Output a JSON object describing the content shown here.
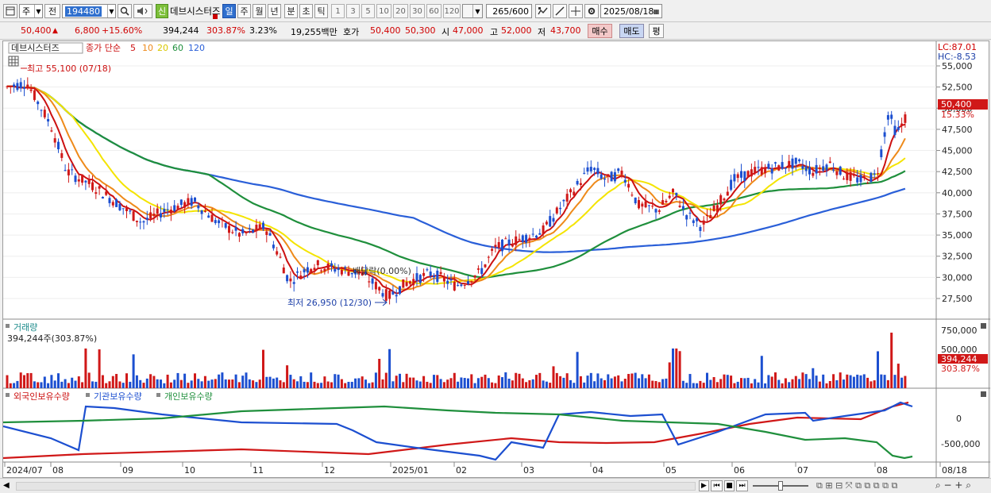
{
  "toolbar": {
    "market_select": "주",
    "type_label": "전",
    "code": "194480",
    "new_badge": "신",
    "stock_name": "데브시스터즈",
    "periods": [
      "일",
      "주",
      "월",
      "년",
      "분",
      "초",
      "틱"
    ],
    "active_period": "일",
    "intervals": [
      "1",
      "3",
      "5",
      "10",
      "20",
      "30",
      "60",
      "120"
    ],
    "count": "265",
    "count_total": "/600",
    "date": "2025/08/18"
  },
  "quote": {
    "price": "50,400",
    "change": "6,800",
    "change_pct": "+15.60%",
    "volume": "394,244",
    "volume_ratio": "303.87%",
    "turnover": "3.23%",
    "amount": "19,255백만",
    "ask_label": "호가",
    "ask": "50,400",
    "bid": "50,300",
    "open_label": "시",
    "open": "47,000",
    "high_label": "고",
    "high": "52,000",
    "low_label": "저",
    "low": "43,700",
    "buy_label": "매수",
    "sell_label": "매도",
    "eval_label": "평"
  },
  "legend": {
    "name": "데브시스터즈",
    "ma_label": "종가 단순",
    "ma_periods": [
      "5",
      "10",
      "20",
      "60",
      "120"
    ],
    "ma_colors": [
      "#cc1010",
      "#ee8a1a",
      "#f4e400",
      "#1f8f3c",
      "#2a5fd8"
    ]
  },
  "annotations": {
    "high": "최고 55,100 (07/18)",
    "low": "최저 26,950 (12/30)",
    "event": "배당락(0.00%)",
    "lc": "LC:87.01",
    "hc": "HC:-8.53",
    "price_tag": "50,400",
    "pct_tag": "15.33%"
  },
  "price_axis": [
    "55,000",
    "52,500",
    "50,000",
    "47,500",
    "45,000",
    "42,500",
    "40,000",
    "37,500",
    "35,000",
    "32,500",
    "30,000",
    "27,500"
  ],
  "volume_pane": {
    "title": "거래량",
    "value": "394,244주(303.87%)",
    "axis": [
      "750,000",
      "500,000"
    ],
    "tag": "394,244",
    "pct": "303.87%"
  },
  "holdings_pane": {
    "foreign": "외국인보유수량",
    "institution": "기관보유수량",
    "individual": "개인보유수량",
    "axis": [
      "0",
      "-500,000"
    ]
  },
  "x_axis": [
    "2024/07",
    "08",
    "09",
    "10",
    "11",
    "12",
    "2025/01",
    "02",
    "03",
    "04",
    "05",
    "06",
    "07",
    "08",
    "08/18"
  ],
  "colors": {
    "up": "#d01818",
    "down": "#1c4fd0",
    "ma5": "#cc1010",
    "ma10": "#ee8a1a",
    "ma20": "#f4e400",
    "ma60": "#1f8f3c",
    "ma120": "#2a5fd8"
  }
}
